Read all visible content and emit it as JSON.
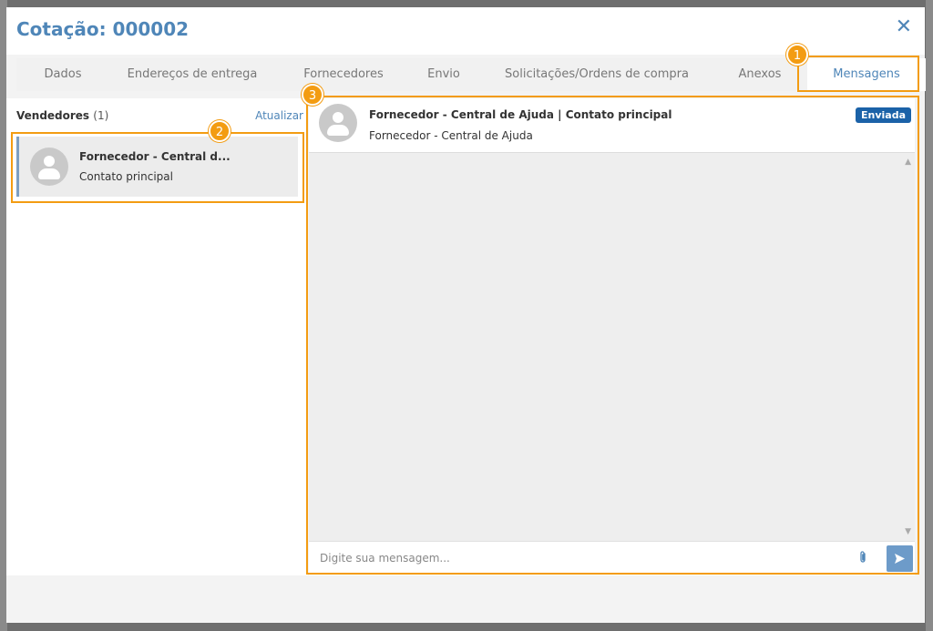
{
  "modal": {
    "title": "Cotação: 000002",
    "close_label": "✕"
  },
  "tabs": [
    {
      "label": "Dados"
    },
    {
      "label": "Endereços de entrega"
    },
    {
      "label": "Fornecedores"
    },
    {
      "label": "Envio"
    },
    {
      "label": "Solicitações/Ordens de compra"
    },
    {
      "label": "Anexos"
    },
    {
      "label": "Mensagens",
      "active": true
    }
  ],
  "vendors": {
    "label": "Vendedores",
    "count": "(1)",
    "refresh_label": "Atualizar",
    "items": [
      {
        "name": "Fornecedor - Central d...",
        "contact": "Contato principal"
      }
    ]
  },
  "chat": {
    "title": "Fornecedor - Central de Ajuda | Contato principal",
    "subtitle": "Fornecedor - Central de Ajuda",
    "status": "Enviada",
    "input_placeholder": "Digite sua mensagem...",
    "attach_icon": "paperclip-icon",
    "send_icon": "send-icon"
  },
  "callouts": [
    {
      "number": "1"
    },
    {
      "number": "2"
    },
    {
      "number": "3"
    }
  ],
  "colors": {
    "accent": "#4f86b8",
    "callout": "#f39c12",
    "badge": "#1b62a8"
  }
}
